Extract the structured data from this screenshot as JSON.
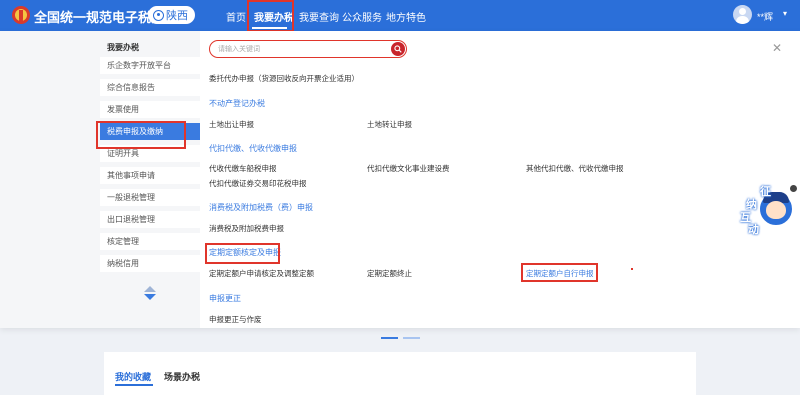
{
  "header": {
    "site_title": "全国统一规范电子税务局",
    "region": "陕西",
    "nav": [
      {
        "label": "首页"
      },
      {
        "label": "我要办税"
      },
      {
        "label": "我要查询"
      },
      {
        "label": "公众服务"
      },
      {
        "label": "地方特色"
      }
    ],
    "username": "**辉",
    "colors": {
      "brand": "#2b6fd9",
      "highlight": "#e0352b"
    }
  },
  "sidebar": {
    "title": "我要办税",
    "items": [
      {
        "label": "乐企数字开放平台"
      },
      {
        "label": "综合信息报告"
      },
      {
        "label": "发票使用"
      },
      {
        "label": "税费申报及缴纳"
      },
      {
        "label": "证明开具"
      },
      {
        "label": "其他事项申请"
      },
      {
        "label": "一般退税管理"
      },
      {
        "label": "出口退税管理"
      },
      {
        "label": "核定管理"
      },
      {
        "label": "纳税信用"
      }
    ]
  },
  "search": {
    "placeholder": "请输入关键词"
  },
  "content": {
    "partial_top": "委托代办申报（货源回收反向开票企业适用）",
    "categories": [
      {
        "title": "不动产登记办税",
        "tasks": [
          "土地出让申报",
          "土地转让申报"
        ]
      },
      {
        "title": "代扣代缴、代收代缴申报",
        "tasks": [
          "代收代缴车船税申报",
          "代扣代缴文化事业建设费",
          "其他代扣代缴、代收代缴申报",
          "代扣代缴证券交易印花税申报"
        ]
      },
      {
        "title": "消费税及附加税费（费）申报",
        "tasks": [
          "消费税及附加税费申报"
        ]
      },
      {
        "title": "定期定额核定及申报",
        "tasks": [
          "定期定额户申请核定及调整定额",
          "定期定额终止",
          "定期定额户自行申报"
        ]
      },
      {
        "title": "申报更正",
        "tasks": [
          "申报更正与作废"
        ]
      }
    ]
  },
  "helper": {
    "chars": [
      "征",
      "纳",
      "互",
      "动"
    ]
  },
  "bottom": {
    "tabs": [
      {
        "label": "我的收藏"
      },
      {
        "label": "场景办税"
      }
    ]
  }
}
